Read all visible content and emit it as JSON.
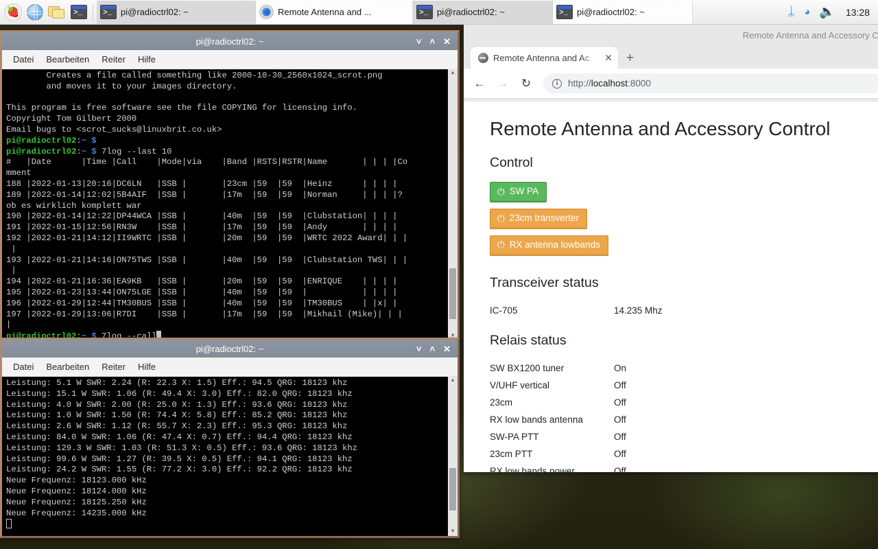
{
  "taskbar": {
    "launchers": [
      {
        "name": "raspberry-menu",
        "glyph": "🍓"
      },
      {
        "name": "web-browser",
        "glyph": ""
      },
      {
        "name": "file-manager",
        "glyph": ""
      },
      {
        "name": "terminal",
        "glyph": ">_"
      }
    ],
    "tasks": [
      {
        "label": "pi@radioctrl02: ~",
        "icon": "terminal-icon",
        "active": false
      },
      {
        "label": "Remote Antenna and ...",
        "icon": "chrome-icon",
        "active": true
      },
      {
        "label": "pi@radioctrl02: ~",
        "icon": "terminal-icon",
        "active": false
      },
      {
        "label": "pi@radioctrl02: ~",
        "icon": "terminal-icon",
        "active": true
      }
    ],
    "tray": {
      "bluetooth": "ᛦ",
      "wifi": "wifi-icon",
      "volume": "🔊",
      "clock": "13:28"
    }
  },
  "terminal1": {
    "title": "pi@radioctrl02: ~",
    "menu": [
      "Datei",
      "Bearbeiten",
      "Reiter",
      "Hilfe"
    ],
    "buttons": {
      "minimize": "˅",
      "maximize": "˄",
      "close": "✕"
    },
    "prompt": "pi@radioctrl02",
    "lines": [
      "        Creates a file called something like 2000-10-30_2560x1024_scrot.png",
      "        and moves it to your images directory.",
      "",
      "This program is free software see the file COPYING for licensing info.",
      "Copyright Tom Gilbert 2000",
      "Email bugs to <scrot_sucks@linuxbrit.co.uk>"
    ],
    "cmd1": "7log --last 10",
    "header": "#   |Date      |Time |Call    |Mode|via    |Band |RSTS|RSTR|Name       | | | |Comment",
    "rows": [
      "188 |2022-01-13|20:16|DC6LN   |SSB |       |23cm |59  |59  |Heinz      | | | |",
      "189 |2022-01-14|12:02|5B4AIF  |SSB |       |17m  |59  |59  |Norman     | | | |? ob es wirklich komplett war",
      "190 |2022-01-14|12:22|DP44WCA |SSB |       |40m  |59  |59  |Clubstation| | | |",
      "191 |2022-01-15|12:56|RN3W    |SSB |       |17m  |59  |59  |Andy       | | | |",
      "192 |2022-01-21|14:12|II9WRTC |SSB |       |20m  |59  |59  |WRTC 2022 Award| | | |",
      "193 |2022-01-21|14:16|ON75TWS |SSB |       |40m  |59  |59  |Clubstation TWS| | | |",
      "194 |2022-01-21|16:36|EA9KB   |SSB |       |20m  |59  |59  |ENRIQUE    | | | |",
      "195 |2022-01-23|13:44|ON75LGE |SSB |       |40m  |59  |59  |           | | | |",
      "196 |2022-01-29|12:44|TM30BUS |SSB |       |40m  |59  |59  |TM30BUS    | |x| |",
      "197 |2022-01-29|13:06|R7DI    |SSB |       |17m  |59  |59  |Mikhail (Mike)| | | |"
    ],
    "cmd2": "7log --call"
  },
  "terminal2": {
    "title": "pi@radioctrl02: ~",
    "menu": [
      "Datei",
      "Bearbeiten",
      "Reiter",
      "Hilfe"
    ],
    "buttons": {
      "minimize": "˅",
      "maximize": "˄",
      "close": "✕"
    },
    "lines": [
      "Leistung: 5.1 W SWR: 2.24 (R: 22.3 X: 1.5) Eff.: 94.5 QRG: 18123 khz",
      "Leistung: 15.1 W SWR: 1.06 (R: 49.4 X: 3.0) Eff.: 82.0 QRG: 18123 khz",
      "Leistung: 4.0 W SWR: 2.00 (R: 25.0 X: 1.3) Eff.: 93.6 QRG: 18123 khz",
      "Leistung: 1.0 W SWR: 1.50 (R: 74.4 X: 5.8) Eff.: 85.2 QRG: 18123 khz",
      "Leistung: 2.6 W SWR: 1.12 (R: 55.7 X: 2.3) Eff.: 95.3 QRG: 18123 khz",
      "Leistung: 84.0 W SWR: 1.06 (R: 47.4 X: 0.7) Eff.: 94.4 QRG: 18123 khz",
      "Leistung: 129.3 W SWR: 1.03 (R: 51.3 X: 0.5) Eff.: 93.6 QRG: 18123 khz",
      "Leistung: 99.6 W SWR: 1.27 (R: 39.5 X: 0.5) Eff.: 94.1 QRG: 18123 khz",
      "Leistung: 24.2 W SWR: 1.55 (R: 77.2 X: 3.0) Eff.: 92.2 QRG: 18123 khz",
      "Neue Frequenz: 18123.000 kHz",
      "Neue Frequenz: 18124.000 kHz",
      "Neue Frequenz: 18125.250 kHz",
      "Neue Frequenz: 14235.000 kHz"
    ]
  },
  "browser": {
    "window_title": "Remote Antenna and Accessory Co",
    "tab": {
      "title": "Remote Antenna and Ac",
      "close": "✕"
    },
    "newtab": "+",
    "nav": {
      "back": "←",
      "forward": "→",
      "reload": "↻",
      "info": "i"
    },
    "url_scheme": "http://",
    "url_host": "localhost",
    "url_port": ":8000",
    "page": {
      "title": "Remote Antenna and Accessory Control",
      "control_heading": "Control",
      "buttons": [
        {
          "label": "SW PA",
          "state": "on",
          "color": "#5cb85c",
          "icon": "power-icon"
        },
        {
          "label": "23cm transverter",
          "state": "off",
          "color": "#eda64a",
          "icon": "power-icon"
        },
        {
          "label": "RX antenna lowbands",
          "state": "off",
          "color": "#eda64a",
          "icon": "power-icon"
        }
      ],
      "transceiver_heading": "Transceiver status",
      "transceiver": {
        "name": "IC-705",
        "value": "14.235 Mhz"
      },
      "relais_heading": "Relais status",
      "relais": [
        {
          "name": "SW BX1200 tuner",
          "value": "On"
        },
        {
          "name": "V/UHF vertical",
          "value": "Off"
        },
        {
          "name": "23cm",
          "value": "Off"
        },
        {
          "name": "RX low bands antenna",
          "value": "Off"
        },
        {
          "name": "SW-PA PTT",
          "value": "Off"
        },
        {
          "name": "23cm PTT",
          "value": "Off"
        },
        {
          "name": "RX low bands power",
          "value": "Off"
        }
      ]
    }
  }
}
